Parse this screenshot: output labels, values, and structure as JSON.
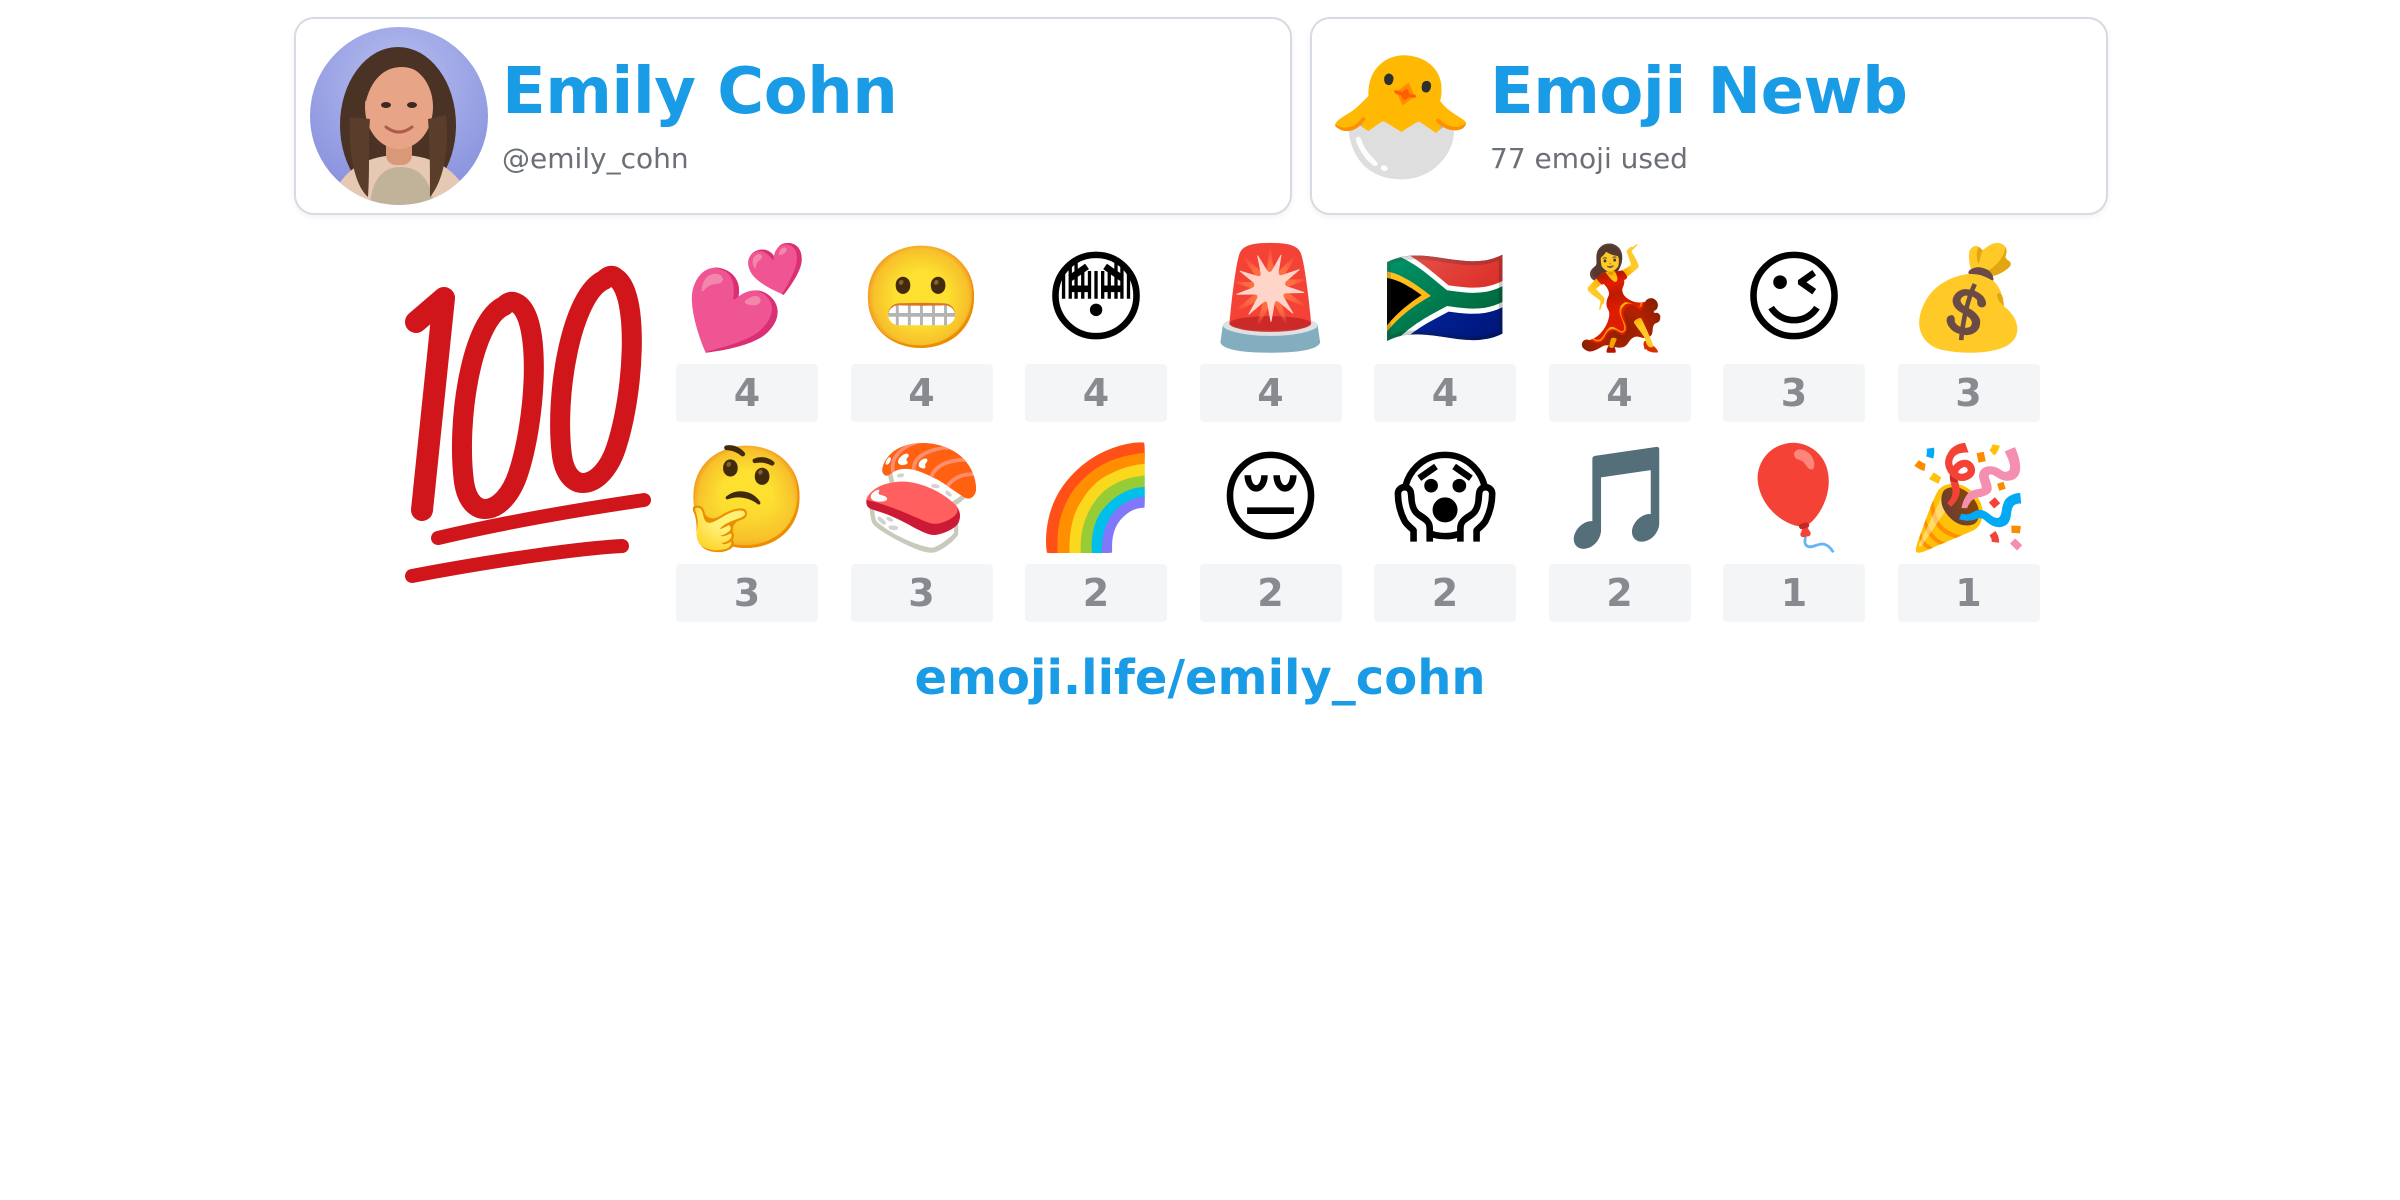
{
  "profile": {
    "name": "Emily Cohn",
    "handle": "@emily_cohn"
  },
  "rank": {
    "emoji": "🐣",
    "title": "Emoji Newb",
    "subtitle": "77 emoji used"
  },
  "featured_emoji": "💯",
  "emoji_stats": [
    {
      "emoji": "💕",
      "icon": "two-hearts-icon",
      "count": "4"
    },
    {
      "emoji": "😬",
      "icon": "grimacing-face-icon",
      "count": "4"
    },
    {
      "emoji": "😳",
      "icon": "flushed-face-icon",
      "count": "4"
    },
    {
      "emoji": "🚨",
      "icon": "police-light-icon",
      "count": "4"
    },
    {
      "emoji": "🇿🇦",
      "icon": "south-africa-flag-icon",
      "count": "4"
    },
    {
      "emoji": "💃",
      "icon": "woman-dancing-icon",
      "count": "4"
    },
    {
      "emoji": "😉",
      "icon": "winking-face-icon",
      "count": "3"
    },
    {
      "emoji": "💰",
      "icon": "money-bag-icon",
      "count": "3"
    },
    {
      "emoji": "🤔",
      "icon": "thinking-face-icon",
      "count": "3"
    },
    {
      "emoji": "🍣",
      "icon": "sushi-icon",
      "count": "3"
    },
    {
      "emoji": "🌈",
      "icon": "rainbow-icon",
      "count": "2"
    },
    {
      "emoji": "😔",
      "icon": "pensive-face-icon",
      "count": "2"
    },
    {
      "emoji": "😱",
      "icon": "screaming-face-icon",
      "count": "2"
    },
    {
      "emoji": "🎵",
      "icon": "musical-note-icon",
      "count": "2"
    },
    {
      "emoji": "🎈",
      "icon": "balloon-icon",
      "count": "1"
    },
    {
      "emoji": "🎉",
      "icon": "party-popper-icon",
      "count": "1"
    }
  ],
  "link": {
    "text": "emoji.life/emily_cohn"
  },
  "colors": {
    "accent": "#1a9be6",
    "subtext": "#6b6f76",
    "count_text": "#878b90",
    "count_bg": "#f4f5f7",
    "card_border": "#d6dae2",
    "hundred_red": "#d0151b"
  }
}
